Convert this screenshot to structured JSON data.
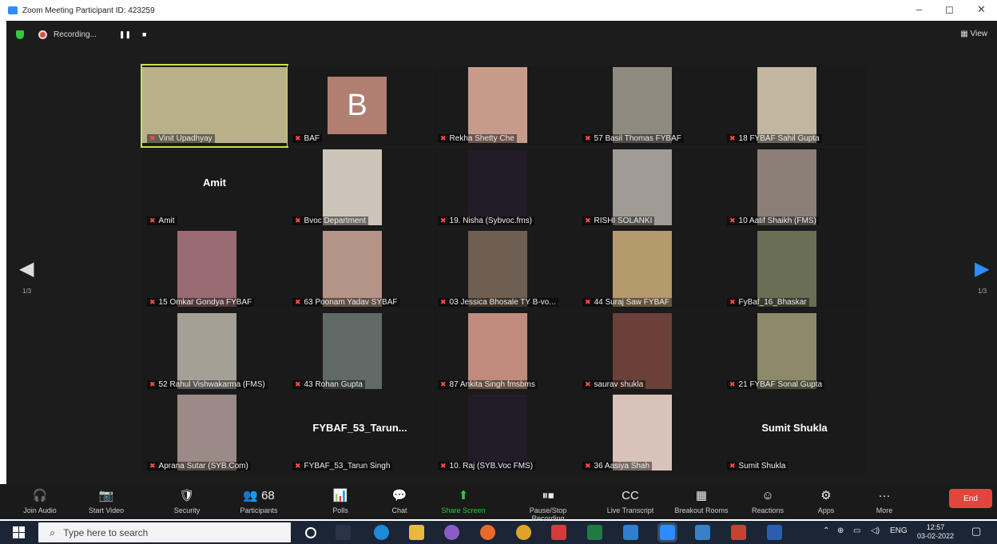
{
  "window": {
    "title": "Zoom Meeting Participant ID: 423259",
    "minimize": "–",
    "maximize": "◻",
    "close": "✕"
  },
  "topbar": {
    "recording": "Recording...",
    "view": "▦ View"
  },
  "nav": {
    "prev": "◀",
    "next": "▶",
    "page_left": "1/3",
    "page_right": "1/3"
  },
  "tiles": [
    {
      "name": "Vinit Upadhyay",
      "bg": "#b9b08a",
      "active": true
    },
    {
      "name": "BAF",
      "avatar": "B"
    },
    {
      "name": "Rekha Shetty Che",
      "bg": "#c79b8a"
    },
    {
      "name": "57 Basil Thomas FYBAF",
      "bg": "#8f8a80"
    },
    {
      "name": "18 FYBAF Sahil Gupta",
      "bg": "#c3b6a0"
    },
    {
      "name": "Amit",
      "big": "Amit"
    },
    {
      "name": "Bvoc Department",
      "bg": "#ccc4b8"
    },
    {
      "name": "19. Nisha (Sybvoc.fms)",
      "bg": "#221c28"
    },
    {
      "name": "RISHI SOLANKI",
      "bg": "#a09b95"
    },
    {
      "name": "10 Aatif Shaikh (FMS)",
      "bg": "#8c7f78"
    },
    {
      "name": "15 Omkar Gondya FYBAF",
      "bg": "#9a6b72"
    },
    {
      "name": "63 Poonam Yadav SYBAF",
      "bg": "#b49486"
    },
    {
      "name": "03 Jessica Bhosale TY B-vo...",
      "bg": "#6f5f52"
    },
    {
      "name": "44 Suraj Saw FYBAF",
      "bg": "#b59a6e"
    },
    {
      "name": "FyBaf_16_Bhaskar",
      "bg": "#6a6e55"
    },
    {
      "name": "52 Rahul Vishwakarma (FMS)",
      "bg": "#a4a096"
    },
    {
      "name": "43 Rohan Gupta",
      "bg": "#5f6a66"
    },
    {
      "name": "87 Ankita Singh fmsbms",
      "bg": "#c08a7c"
    },
    {
      "name": "saurav shukla",
      "bg": "#6b4038"
    },
    {
      "name": "21 FYBAF Sonal Gupta",
      "bg": "#8c8a6a"
    },
    {
      "name": "Aprana Sutar (SYB.Com)",
      "bg": "#9b8a86"
    },
    {
      "name": "FYBAF_53_Tarun Singh",
      "big": "FYBAF_53_Tarun..."
    },
    {
      "name": "10. Raj (SYB.Voc FMS)",
      "bg": "#221c28"
    },
    {
      "name": "36 Aasiya Shah",
      "bg": "#d9c2b9"
    },
    {
      "name": "Sumit Shukla",
      "big": "Sumit Shukla"
    }
  ],
  "toolbar": [
    {
      "icon": "🎧",
      "label": "Join Audio"
    },
    {
      "icon": "📷",
      "label": "Start Video"
    },
    {
      "icon": "🛡",
      "label": "Security"
    },
    {
      "icon": "👥 68",
      "label": "Participants"
    },
    {
      "icon": "📊",
      "label": "Polls"
    },
    {
      "icon": "💬",
      "label": "Chat"
    },
    {
      "icon": "⬆",
      "label": "Share Screen"
    },
    {
      "icon": "⏸⏹",
      "label": "Pause/Stop Recording"
    },
    {
      "icon": "CC",
      "label": "Live Transcript"
    },
    {
      "icon": "▦",
      "label": "Breakout Rooms"
    },
    {
      "icon": "☺",
      "label": "Reactions"
    },
    {
      "icon": "⚙",
      "label": "Apps"
    },
    {
      "icon": "···",
      "label": "More"
    }
  ],
  "end_label": "End",
  "taskbar": {
    "search_placeholder": "Type here to search",
    "lang": "ENG",
    "time": "12:57",
    "date": "03-02-2022"
  }
}
